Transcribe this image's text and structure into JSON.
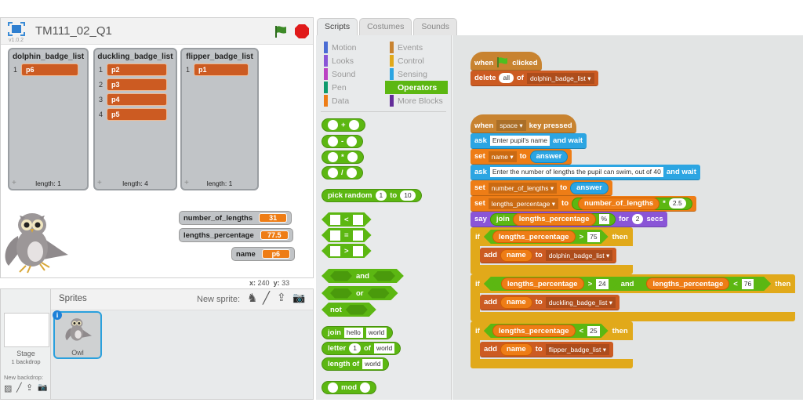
{
  "colors": {
    "events": "#c88330",
    "control": "#e1a91a",
    "sensing": "#2ca5e2",
    "data": "#ee7d16",
    "list": "#cc5b22",
    "operators": "#5cb712",
    "looks": "#8a55d7",
    "motion": "#4a6cd4",
    "sound": "#bb42c3",
    "pen": "#0e9a6c",
    "more": "#632d99"
  },
  "stage": {
    "title": "TM111_02_Q1",
    "version": "v1.0.2",
    "lists": [
      {
        "title": "dolphin_badge_list",
        "items": [
          "p6"
        ],
        "length": "length: 1"
      },
      {
        "title": "duckling_badge_list",
        "items": [
          "p2",
          "p3",
          "p4",
          "p5"
        ],
        "length": "length: 4"
      },
      {
        "title": "flipper_badge_list",
        "items": [
          "p1"
        ],
        "length": "length: 1"
      }
    ],
    "variables": [
      {
        "name": "number_of_lengths",
        "value": "31"
      },
      {
        "name": "lengths_percentage",
        "value": "77.5"
      },
      {
        "name": "name",
        "value": "p6"
      }
    ],
    "coords": {
      "x_label": "x:",
      "x": "240",
      "y_label": "y:",
      "y": "33"
    }
  },
  "sprites": {
    "header": "Sprites",
    "new_sprite": "New sprite:",
    "stage_label": "Stage",
    "backdrops": "1 backdrop",
    "new_backdrop": "New backdrop:",
    "items": [
      {
        "name": "Owl"
      }
    ]
  },
  "tabs": [
    {
      "label": "Scripts",
      "active": true
    },
    {
      "label": "Costumes"
    },
    {
      "label": "Sounds"
    }
  ],
  "categories": [
    {
      "label": "Motion",
      "c": "motion"
    },
    {
      "label": "Events",
      "c": "events"
    },
    {
      "label": "Looks",
      "c": "looks"
    },
    {
      "label": "Control",
      "c": "control"
    },
    {
      "label": "Sound",
      "c": "sound"
    },
    {
      "label": "Sensing",
      "c": "sensing"
    },
    {
      "label": "Pen",
      "c": "pen"
    },
    {
      "label": "Operators",
      "c": "operators",
      "selected": true
    },
    {
      "label": "Data",
      "c": "data"
    },
    {
      "label": "More Blocks",
      "c": "more"
    }
  ],
  "palette": {
    "blocks": [
      {
        "shape": "rep",
        "parts": [
          {
            "k": "slot"
          },
          {
            "k": "t",
            "v": "+"
          },
          {
            "k": "slot"
          }
        ]
      },
      {
        "shape": "rep",
        "parts": [
          {
            "k": "slot"
          },
          {
            "k": "t",
            "v": "-"
          },
          {
            "k": "slot"
          }
        ]
      },
      {
        "shape": "rep",
        "parts": [
          {
            "k": "slot"
          },
          {
            "k": "t",
            "v": "*"
          },
          {
            "k": "slot"
          }
        ]
      },
      {
        "shape": "rep",
        "parts": [
          {
            "k": "slot"
          },
          {
            "k": "t",
            "v": "/"
          },
          {
            "k": "slot"
          }
        ]
      },
      {
        "shape": "rep",
        "parts": [
          {
            "k": "t",
            "v": "pick random"
          },
          {
            "k": "num",
            "v": "1"
          },
          {
            "k": "t",
            "v": "to"
          },
          {
            "k": "num",
            "v": "10"
          }
        ]
      },
      {
        "shape": "bool",
        "parts": [
          {
            "k": "box"
          },
          {
            "k": "t",
            "v": "<"
          },
          {
            "k": "box"
          }
        ]
      },
      {
        "shape": "bool",
        "parts": [
          {
            "k": "box"
          },
          {
            "k": "t",
            "v": "="
          },
          {
            "k": "box"
          }
        ]
      },
      {
        "shape": "bool",
        "parts": [
          {
            "k": "box"
          },
          {
            "k": "t",
            "v": ">"
          },
          {
            "k": "box"
          }
        ]
      },
      {
        "shape": "bool",
        "parts": [
          {
            "k": "hexslot"
          },
          {
            "k": "t",
            "v": "and"
          },
          {
            "k": "hexslot"
          }
        ]
      },
      {
        "shape": "bool",
        "parts": [
          {
            "k": "hexslot"
          },
          {
            "k": "t",
            "v": "or"
          },
          {
            "k": "hexslot"
          }
        ]
      },
      {
        "shape": "bool",
        "parts": [
          {
            "k": "t",
            "v": "not"
          },
          {
            "k": "hexslot"
          }
        ]
      },
      {
        "shape": "rep",
        "parts": [
          {
            "k": "t",
            "v": "join"
          },
          {
            "k": "txt",
            "v": "hello"
          },
          {
            "k": "txt",
            "v": "world"
          }
        ]
      },
      {
        "shape": "rep",
        "parts": [
          {
            "k": "t",
            "v": "letter"
          },
          {
            "k": "num",
            "v": "1"
          },
          {
            "k": "t",
            "v": "of"
          },
          {
            "k": "txt",
            "v": "world"
          }
        ]
      },
      {
        "shape": "rep",
        "parts": [
          {
            "k": "t",
            "v": "length of"
          },
          {
            "k": "txt",
            "v": "world"
          }
        ]
      },
      {
        "shape": "rep",
        "parts": [
          {
            "k": "slot"
          },
          {
            "k": "t",
            "v": "mod"
          },
          {
            "k": "slot"
          }
        ]
      }
    ]
  },
  "scripts": [
    {
      "blocks": [
        {
          "cat": "events",
          "hat": true,
          "parts": [
            {
              "k": "t",
              "v": "when"
            },
            {
              "k": "flag"
            },
            {
              "k": "t",
              "v": "clicked"
            }
          ]
        },
        {
          "cat": "list",
          "parts": [
            {
              "k": "t",
              "v": "delete"
            },
            {
              "k": "num",
              "v": "all"
            },
            {
              "k": "t",
              "v": "of"
            },
            {
              "k": "dd",
              "v": "dolphin_badge_list"
            }
          ]
        }
      ]
    },
    {
      "blocks": [
        {
          "cat": "events",
          "hat": true,
          "parts": [
            {
              "k": "t",
              "v": "when"
            },
            {
              "k": "dd",
              "v": "space"
            },
            {
              "k": "t",
              "v": "key pressed"
            }
          ]
        },
        {
          "cat": "sensing",
          "parts": [
            {
              "k": "t",
              "v": "ask"
            },
            {
              "k": "txt",
              "v": "Enter pupil's name"
            },
            {
              "k": "t",
              "v": "and wait"
            }
          ]
        },
        {
          "cat": "data",
          "parts": [
            {
              "k": "t",
              "v": "set"
            },
            {
              "k": "dd",
              "v": "name"
            },
            {
              "k": "t",
              "v": "to"
            },
            {
              "k": "rep",
              "c": "sensing",
              "parts": [
                {
                  "k": "t",
                  "v": "answer"
                }
              ]
            }
          ]
        },
        {
          "cat": "sensing",
          "parts": [
            {
              "k": "t",
              "v": "ask"
            },
            {
              "k": "txt",
              "v": "Enter the number of lengths the pupil can swim, out of 40"
            },
            {
              "k": "t",
              "v": "and wait"
            }
          ]
        },
        {
          "cat": "data",
          "parts": [
            {
              "k": "t",
              "v": "set"
            },
            {
              "k": "dd",
              "v": "number_of_lengths"
            },
            {
              "k": "t",
              "v": "to"
            },
            {
              "k": "rep",
              "c": "sensing",
              "parts": [
                {
                  "k": "t",
                  "v": "answer"
                }
              ]
            }
          ]
        },
        {
          "cat": "data",
          "parts": [
            {
              "k": "t",
              "v": "set"
            },
            {
              "k": "dd",
              "v": "lengths_percentage"
            },
            {
              "k": "t",
              "v": "to"
            },
            {
              "k": "rep",
              "c": "operators",
              "parts": [
                {
                  "k": "rep",
                  "c": "data",
                  "parts": [
                    {
                      "k": "t",
                      "v": "number_of_lengths"
                    }
                  ]
                },
                {
                  "k": "t",
                  "v": "*"
                },
                {
                  "k": "num",
                  "v": "2.5"
                }
              ]
            }
          ]
        },
        {
          "cat": "looks",
          "parts": [
            {
              "k": "t",
              "v": "say"
            },
            {
              "k": "rep",
              "c": "operators",
              "parts": [
                {
                  "k": "t",
                  "v": "join"
                },
                {
                  "k": "rep",
                  "c": "data",
                  "parts": [
                    {
                      "k": "t",
                      "v": "lengths_percentage"
                    }
                  ]
                },
                {
                  "k": "txt",
                  "v": "%"
                }
              ]
            },
            {
              "k": "t",
              "v": "for"
            },
            {
              "k": "num",
              "v": "2"
            },
            {
              "k": "t",
              "v": "secs"
            }
          ]
        },
        {
          "cat": "control",
          "c": true,
          "parts": [
            {
              "k": "t",
              "v": "if"
            },
            {
              "k": "bool",
              "parts": [
                {
                  "k": "rep",
                  "c": "data",
                  "parts": [
                    {
                      "k": "t",
                      "v": "lengths_percentage"
                    }
                  ]
                },
                {
                  "k": "t",
                  "v": ">"
                },
                {
                  "k": "box",
                  "v": "75"
                }
              ]
            },
            {
              "k": "t",
              "v": "then"
            }
          ],
          "inner": [
            {
              "cat": "list",
              "parts": [
                {
                  "k": "t",
                  "v": "add"
                },
                {
                  "k": "rep",
                  "c": "data",
                  "parts": [
                    {
                      "k": "t",
                      "v": "name"
                    }
                  ]
                },
                {
                  "k": "t",
                  "v": "to"
                },
                {
                  "k": "dd",
                  "v": "dolphin_badge_list"
                }
              ]
            }
          ]
        },
        {
          "cat": "control",
          "c": true,
          "parts": [
            {
              "k": "t",
              "v": "if"
            },
            {
              "k": "bool",
              "parts": [
                {
                  "k": "bool",
                  "parts": [
                    {
                      "k": "rep",
                      "c": "data",
                      "parts": [
                        {
                          "k": "t",
                          "v": "lengths_percentage"
                        }
                      ]
                    },
                    {
                      "k": "t",
                      "v": ">"
                    },
                    {
                      "k": "box",
                      "v": "24"
                    }
                  ]
                },
                {
                  "k": "t",
                  "v": "and"
                },
                {
                  "k": "bool",
                  "parts": [
                    {
                      "k": "rep",
                      "c": "data",
                      "parts": [
                        {
                          "k": "t",
                          "v": "lengths_percentage"
                        }
                      ]
                    },
                    {
                      "k": "t",
                      "v": "<"
                    },
                    {
                      "k": "box",
                      "v": "76"
                    }
                  ]
                }
              ]
            },
            {
              "k": "t",
              "v": "then"
            }
          ],
          "inner": [
            {
              "cat": "list",
              "parts": [
                {
                  "k": "t",
                  "v": "add"
                },
                {
                  "k": "rep",
                  "c": "data",
                  "parts": [
                    {
                      "k": "t",
                      "v": "name"
                    }
                  ]
                },
                {
                  "k": "t",
                  "v": "to"
                },
                {
                  "k": "dd",
                  "v": "duckling_badge_list"
                }
              ]
            }
          ]
        },
        {
          "cat": "control",
          "c": true,
          "parts": [
            {
              "k": "t",
              "v": "if"
            },
            {
              "k": "bool",
              "parts": [
                {
                  "k": "rep",
                  "c": "data",
                  "parts": [
                    {
                      "k": "t",
                      "v": "lengths_percentage"
                    }
                  ]
                },
                {
                  "k": "t",
                  "v": "<"
                },
                {
                  "k": "box",
                  "v": "25"
                }
              ]
            },
            {
              "k": "t",
              "v": "then"
            }
          ],
          "inner": [
            {
              "cat": "list",
              "parts": [
                {
                  "k": "t",
                  "v": "add"
                },
                {
                  "k": "rep",
                  "c": "data",
                  "parts": [
                    {
                      "k": "t",
                      "v": "name"
                    }
                  ]
                },
                {
                  "k": "t",
                  "v": "to"
                },
                {
                  "k": "dd",
                  "v": "flipper_badge_list"
                }
              ]
            }
          ]
        }
      ]
    }
  ]
}
